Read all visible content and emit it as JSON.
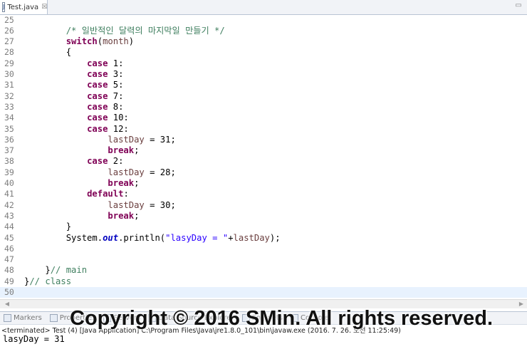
{
  "editor_tab": {
    "icon": "java-file-icon",
    "title": "Test.java",
    "close_glyph": "☒"
  },
  "lines": [
    {
      "n": "25",
      "parts": []
    },
    {
      "n": "26",
      "parts": [
        {
          "t": "        "
        },
        {
          "t": "/* 일반적인 달력의 마지막일 만들기 */",
          "c": "cm"
        }
      ]
    },
    {
      "n": "27",
      "parts": [
        {
          "t": "        "
        },
        {
          "t": "switch",
          "c": "kw"
        },
        {
          "t": "("
        },
        {
          "t": "month",
          "c": "var"
        },
        {
          "t": ")"
        }
      ]
    },
    {
      "n": "28",
      "parts": [
        {
          "t": "        {"
        }
      ]
    },
    {
      "n": "29",
      "parts": [
        {
          "t": "            "
        },
        {
          "t": "case",
          "c": "kw"
        },
        {
          "t": " 1:"
        }
      ]
    },
    {
      "n": "30",
      "parts": [
        {
          "t": "            "
        },
        {
          "t": "case",
          "c": "kw"
        },
        {
          "t": " 3:"
        }
      ]
    },
    {
      "n": "31",
      "parts": [
        {
          "t": "            "
        },
        {
          "t": "case",
          "c": "kw"
        },
        {
          "t": " 5:"
        }
      ]
    },
    {
      "n": "32",
      "parts": [
        {
          "t": "            "
        },
        {
          "t": "case",
          "c": "kw"
        },
        {
          "t": " 7:"
        }
      ]
    },
    {
      "n": "33",
      "parts": [
        {
          "t": "            "
        },
        {
          "t": "case",
          "c": "kw"
        },
        {
          "t": " 8:"
        }
      ]
    },
    {
      "n": "34",
      "parts": [
        {
          "t": "            "
        },
        {
          "t": "case",
          "c": "kw"
        },
        {
          "t": " 10:"
        }
      ]
    },
    {
      "n": "35",
      "parts": [
        {
          "t": "            "
        },
        {
          "t": "case",
          "c": "kw"
        },
        {
          "t": " 12:"
        }
      ]
    },
    {
      "n": "36",
      "parts": [
        {
          "t": "                "
        },
        {
          "t": "lastDay",
          "c": "var"
        },
        {
          "t": " = 31;"
        }
      ]
    },
    {
      "n": "37",
      "parts": [
        {
          "t": "                "
        },
        {
          "t": "break",
          "c": "kw"
        },
        {
          "t": ";"
        }
      ]
    },
    {
      "n": "38",
      "parts": [
        {
          "t": "            "
        },
        {
          "t": "case",
          "c": "kw"
        },
        {
          "t": " 2:"
        }
      ]
    },
    {
      "n": "39",
      "parts": [
        {
          "t": "                "
        },
        {
          "t": "lastDay",
          "c": "var"
        },
        {
          "t": " = 28;"
        }
      ]
    },
    {
      "n": "40",
      "parts": [
        {
          "t": "                "
        },
        {
          "t": "break",
          "c": "kw"
        },
        {
          "t": ";"
        }
      ]
    },
    {
      "n": "41",
      "parts": [
        {
          "t": "            "
        },
        {
          "t": "default",
          "c": "kw"
        },
        {
          "t": ":"
        }
      ]
    },
    {
      "n": "42",
      "parts": [
        {
          "t": "                "
        },
        {
          "t": "lastDay",
          "c": "var"
        },
        {
          "t": " = 30;"
        }
      ]
    },
    {
      "n": "43",
      "parts": [
        {
          "t": "                "
        },
        {
          "t": "break",
          "c": "kw"
        },
        {
          "t": ";"
        }
      ]
    },
    {
      "n": "44",
      "parts": [
        {
          "t": "        }"
        }
      ]
    },
    {
      "n": "45",
      "parts": [
        {
          "t": "        System."
        },
        {
          "t": "out",
          "c": "fld"
        },
        {
          "t": ".println("
        },
        {
          "t": "\"lasyDay = \"",
          "c": "st"
        },
        {
          "t": "+"
        },
        {
          "t": "lastDay",
          "c": "var"
        },
        {
          "t": ");"
        }
      ]
    },
    {
      "n": "46",
      "parts": []
    },
    {
      "n": "47",
      "parts": []
    },
    {
      "n": "48",
      "parts": [
        {
          "t": "    }"
        },
        {
          "t": "// main",
          "c": "cm"
        }
      ]
    },
    {
      "n": "49",
      "parts": [
        {
          "t": "}"
        },
        {
          "t": "// class",
          "c": "cm"
        }
      ]
    },
    {
      "n": "50",
      "parts": [],
      "current": true
    }
  ],
  "panel": {
    "tabs": [
      {
        "label": "Markers",
        "icon": "markers-icon"
      },
      {
        "label": "Properties",
        "icon": "properties-icon"
      },
      {
        "label": "Servers",
        "icon": "servers-icon"
      },
      {
        "label": "Data Source Explorer",
        "icon": "data-source-icon"
      },
      {
        "label": "Snippets",
        "icon": "snippets-icon"
      },
      {
        "label": "Console",
        "icon": "console-icon"
      }
    ],
    "status": "<terminated> Test (4) [Java Application] C:\\Program Files\\Java\\jre1.8.0_101\\bin\\javaw.exe (2016. 7. 26. 오전 11:25:49)",
    "output": "lasyDay = 31"
  },
  "watermark": "Copyright © 2016 SMin. All rights reserved."
}
